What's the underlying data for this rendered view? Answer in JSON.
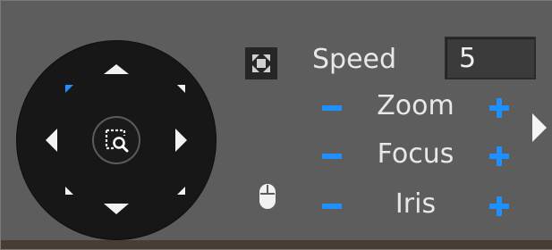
{
  "panel": {
    "accent_color": "#1e90ff",
    "background_color": "#5d5d5d"
  },
  "wheel": {
    "directions": [
      {
        "name": "up",
        "icon": "arrow-up-icon"
      },
      {
        "name": "up-right",
        "icon": "arrow-up-right-icon"
      },
      {
        "name": "right",
        "icon": "arrow-right-icon"
      },
      {
        "name": "down-right",
        "icon": "arrow-down-right-icon"
      },
      {
        "name": "down",
        "icon": "arrow-down-icon"
      },
      {
        "name": "down-left",
        "icon": "arrow-down-left-icon"
      },
      {
        "name": "left",
        "icon": "arrow-left-icon"
      },
      {
        "name": "up-left",
        "icon": "arrow-up-left-icon",
        "highlighted": true
      }
    ],
    "center_icon": "area-zoom-search-icon"
  },
  "fit_button": {
    "icon": "fit-screen-icon"
  },
  "speed": {
    "label": "Speed",
    "value": "5"
  },
  "controls": [
    {
      "label": "Zoom",
      "minus_icon": "minus-icon",
      "plus_icon": "plus-icon"
    },
    {
      "label": "Focus",
      "minus_icon": "minus-icon",
      "plus_icon": "plus-icon"
    },
    {
      "label": "Iris",
      "minus_icon": "minus-icon",
      "plus_icon": "plus-icon"
    }
  ],
  "expand_button": {
    "icon": "triangle-right-icon"
  },
  "mouse": {
    "icon": "mouse-icon"
  }
}
